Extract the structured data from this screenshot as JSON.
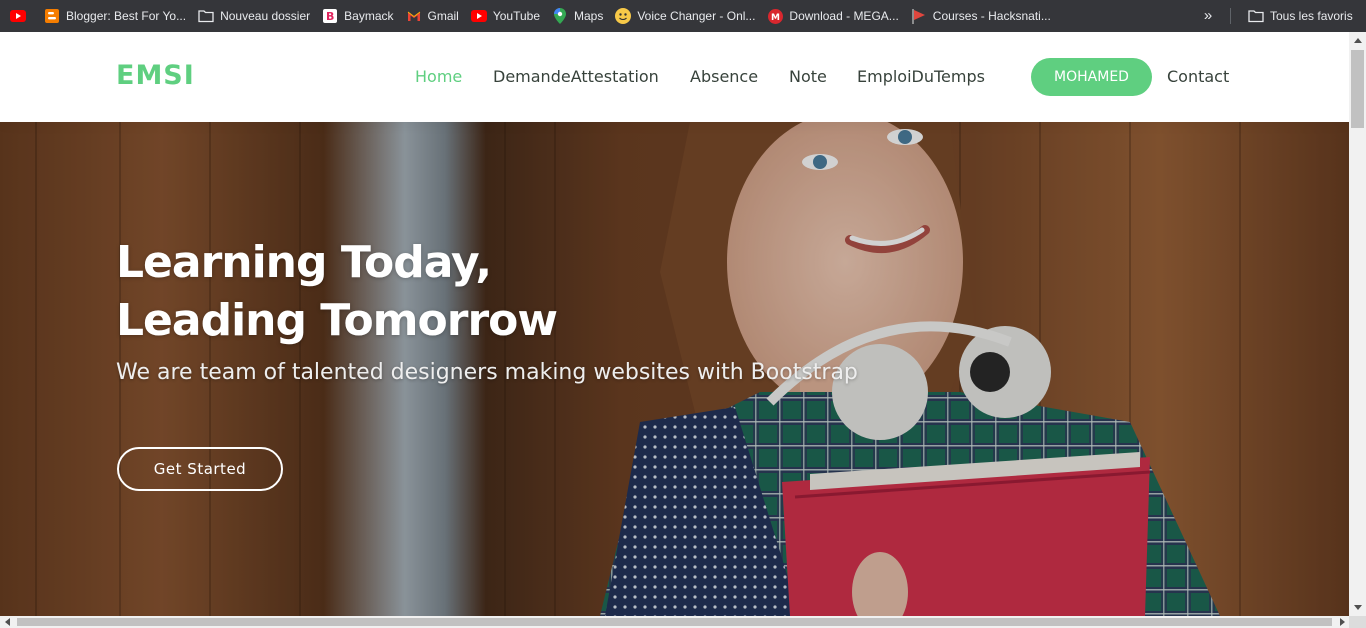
{
  "bookmarks": {
    "items": [
      {
        "label": "",
        "icon": "youtube-icon"
      },
      {
        "label": "Blogger: Best For Yo...",
        "icon": "blogger-icon"
      },
      {
        "label": "Nouveau dossier",
        "icon": "folder-icon"
      },
      {
        "label": "Baymack",
        "icon": "baymack-icon"
      },
      {
        "label": "Gmail",
        "icon": "gmail-icon"
      },
      {
        "label": "YouTube",
        "icon": "youtube-icon"
      },
      {
        "label": "Maps",
        "icon": "maps-pin-icon"
      },
      {
        "label": "Voice Changer - Onl...",
        "icon": "voice-changer-icon"
      },
      {
        "label": "Download - MEGA...",
        "icon": "mega-icon"
      },
      {
        "label": "Courses - Hacksnati...",
        "icon": "courses-flag-icon"
      }
    ],
    "overflow_icon": "chevron-double-right-icon",
    "all_bookmarks_label": "Tous les favoris"
  },
  "header": {
    "logo": "EMSI",
    "nav": {
      "home": "Home",
      "attestation": "DemandeAttestation",
      "absence": "Absence",
      "note": "Note",
      "emploi": "EmploiDuTemps",
      "contact": "Contact"
    },
    "user_button": "MOHAMED"
  },
  "hero": {
    "title_line1": "Learning Today,",
    "title_line2": "Leading Tomorrow",
    "subtitle": "We are team of talented designers making websites with Bootstrap",
    "cta": "Get Started"
  },
  "colors": {
    "accent": "#5fcf80",
    "nav_text": "#37423b",
    "bookmarks_bg": "#35363a"
  }
}
